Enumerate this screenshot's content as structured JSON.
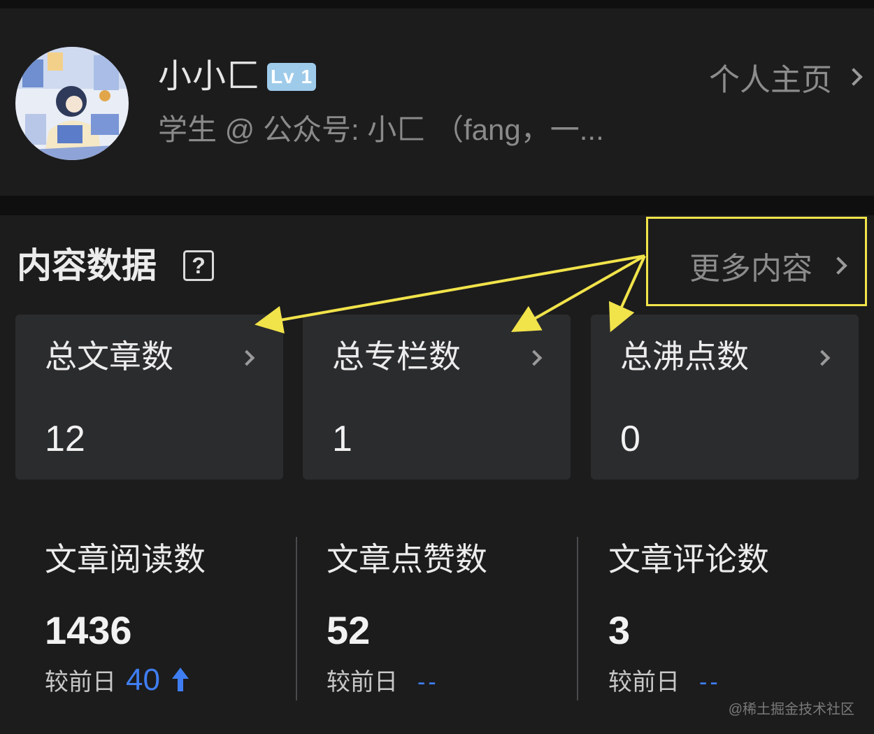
{
  "profile": {
    "username": "小小匚",
    "level_badge": "Lv 1",
    "bio": "学生 @ 公众号: 小匚 （fang，一...",
    "homepage_link": "个人主页"
  },
  "content_data": {
    "title": "内容数据",
    "help_glyph": "?",
    "more_link": "更多内容",
    "cards": [
      {
        "label": "总文章数",
        "value": "12"
      },
      {
        "label": "总专栏数",
        "value": "1"
      },
      {
        "label": "总沸点数",
        "value": "0"
      }
    ],
    "stats": [
      {
        "label": "文章阅读数",
        "value": "1436",
        "compare_label": "较前日",
        "compare_value": "40",
        "trend": "up"
      },
      {
        "label": "文章点赞数",
        "value": "52",
        "compare_label": "较前日",
        "compare_value": "--"
      },
      {
        "label": "文章评论数",
        "value": "3",
        "compare_label": "较前日",
        "compare_value": "--"
      }
    ]
  },
  "annotation": {
    "highlight_color": "#f1e34a"
  },
  "colors": {
    "accent_blue": "#3f7ef2",
    "badge_blue": "#9fcbea"
  },
  "icons": [
    "avatar-illustration",
    "help-icon",
    "chevron-right-icon",
    "arrow-up-icon"
  ],
  "watermark": "@稀土掘金技术社区"
}
